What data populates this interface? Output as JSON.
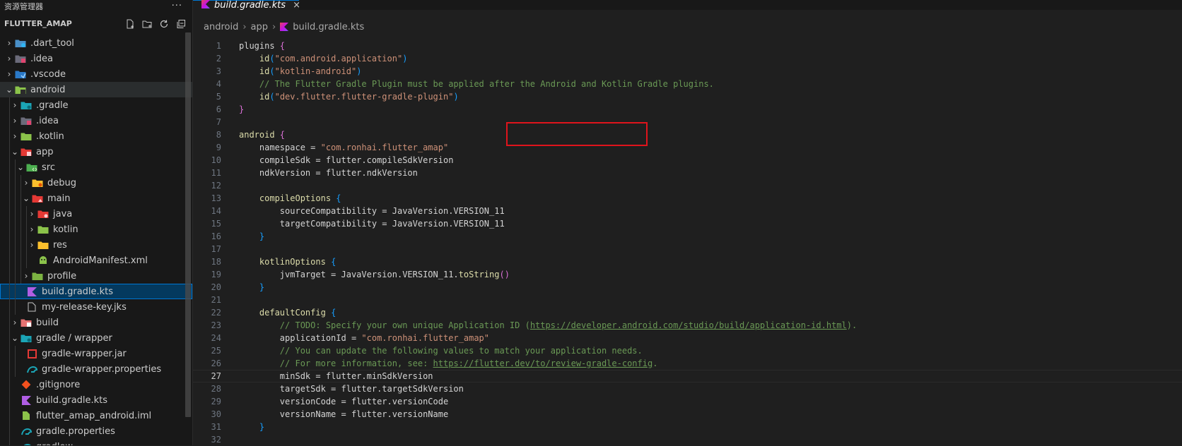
{
  "explorer": {
    "title": "资源管理器",
    "more": "···",
    "root": "FLUTTER_AMAP",
    "items": [
      {
        "label": ".dart_tool",
        "depth": 0,
        "chev": "›",
        "icon": "folder-dart-icon"
      },
      {
        "label": ".idea",
        "depth": 0,
        "chev": "›",
        "icon": "folder-idea-icon"
      },
      {
        "label": ".vscode",
        "depth": 0,
        "chev": "›",
        "icon": "folder-vscode-icon"
      },
      {
        "label": "android",
        "depth": 0,
        "chev": "⌄",
        "icon": "folder-android-icon"
      },
      {
        "label": ".gradle",
        "depth": 1,
        "chev": "›",
        "icon": "folder-gradle-icon"
      },
      {
        "label": ".idea",
        "depth": 1,
        "chev": "›",
        "icon": "folder-idea-icon"
      },
      {
        "label": ".kotlin",
        "depth": 1,
        "chev": "›",
        "icon": "folder-kotlin-icon"
      },
      {
        "label": "app",
        "depth": 1,
        "chev": "⌄",
        "icon": "folder-app-icon"
      },
      {
        "label": "src",
        "depth": 2,
        "chev": "⌄",
        "icon": "folder-src-icon"
      },
      {
        "label": "debug",
        "depth": 3,
        "chev": "›",
        "icon": "folder-debug-icon"
      },
      {
        "label": "main",
        "depth": 3,
        "chev": "⌄",
        "icon": "folder-main-icon"
      },
      {
        "label": "java",
        "depth": 4,
        "chev": "›",
        "icon": "folder-java-icon"
      },
      {
        "label": "kotlin",
        "depth": 4,
        "chev": "›",
        "icon": "folder-kotlin-icon"
      },
      {
        "label": "res",
        "depth": 4,
        "chev": "›",
        "icon": "folder-res-icon"
      },
      {
        "label": "AndroidManifest.xml",
        "depth": 4,
        "chev": "",
        "icon": "android-manifest-icon"
      },
      {
        "label": "profile",
        "depth": 3,
        "chev": "›",
        "icon": "folder-profile-icon"
      },
      {
        "label": "build.gradle.kts",
        "depth": 2,
        "chev": "",
        "icon": "kotlin-file-icon"
      },
      {
        "label": "my-release-key.jks",
        "depth": 2,
        "chev": "",
        "icon": "file-icon"
      },
      {
        "label": "build",
        "depth": 1,
        "chev": "›",
        "icon": "folder-build-icon"
      },
      {
        "label": "gradle / wrapper",
        "depth": 1,
        "chev": "⌄",
        "icon": "folder-gradle-icon"
      },
      {
        "label": "gradle-wrapper.jar",
        "depth": 2,
        "chev": "",
        "icon": "jar-file-icon"
      },
      {
        "label": "gradle-wrapper.properties",
        "depth": 2,
        "chev": "",
        "icon": "gradle-properties-icon"
      },
      {
        "label": ".gitignore",
        "depth": 1,
        "chev": "",
        "icon": "git-icon"
      },
      {
        "label": "build.gradle.kts",
        "depth": 1,
        "chev": "",
        "icon": "kotlin-file-icon"
      },
      {
        "label": "flutter_amap_android.iml",
        "depth": 1,
        "chev": "",
        "icon": "iml-file-icon"
      },
      {
        "label": "gradle.properties",
        "depth": 1,
        "chev": "",
        "icon": "gradle-properties-icon"
      },
      {
        "label": "gradlew",
        "depth": 1,
        "chev": "",
        "icon": "gradle-file-icon"
      }
    ]
  },
  "tab": {
    "label": "build.gradle.kts",
    "close": "×"
  },
  "breadcrumb": [
    "android",
    "app",
    "build.gradle.kts"
  ],
  "code": [
    [
      [
        "plugins ",
        "id"
      ],
      [
        "{",
        "br"
      ]
    ],
    [
      [
        "    ",
        "id"
      ],
      [
        "id",
        "fn"
      ],
      [
        "(",
        "br2"
      ],
      [
        "\"com.android.application\"",
        "str"
      ],
      [
        ")",
        "br2"
      ]
    ],
    [
      [
        "    ",
        "id"
      ],
      [
        "id",
        "fn"
      ],
      [
        "(",
        "br2"
      ],
      [
        "\"kotlin-android\"",
        "str"
      ],
      [
        ")",
        "br2"
      ]
    ],
    [
      [
        "    // The Flutter Gradle Plugin must be applied after the Android and Kotlin Gradle plugins.",
        "cm"
      ]
    ],
    [
      [
        "    ",
        "id"
      ],
      [
        "id",
        "fn"
      ],
      [
        "(",
        "br2"
      ],
      [
        "\"dev.flutter.flutter-gradle-plugin\"",
        "str"
      ],
      [
        ")",
        "br2"
      ]
    ],
    [
      [
        "}",
        "br"
      ]
    ],
    [
      [
        "",
        "id"
      ]
    ],
    [
      [
        "android ",
        "fn"
      ],
      [
        "{",
        "br"
      ]
    ],
    [
      [
        "    namespace = ",
        "id"
      ],
      [
        "\"com.ronhai.flutter_amap\"",
        "str"
      ]
    ],
    [
      [
        "    compileSdk = flutter.compileSdkVersion",
        "id"
      ]
    ],
    [
      [
        "    ndkVersion = flutter.ndkVersion",
        "id"
      ]
    ],
    [
      [
        "",
        "id"
      ]
    ],
    [
      [
        "    ",
        "id"
      ],
      [
        "compileOptions ",
        "fn"
      ],
      [
        "{",
        "br2"
      ]
    ],
    [
      [
        "        sourceCompatibility = JavaVersion.VERSION_11",
        "id"
      ]
    ],
    [
      [
        "        targetCompatibility = JavaVersion.VERSION_11",
        "id"
      ]
    ],
    [
      [
        "    ",
        "id"
      ],
      [
        "}",
        "br2"
      ]
    ],
    [
      [
        "",
        "id"
      ]
    ],
    [
      [
        "    ",
        "id"
      ],
      [
        "kotlinOptions ",
        "fn"
      ],
      [
        "{",
        "br2"
      ]
    ],
    [
      [
        "        jvmTarget = JavaVersion.VERSION_11.",
        "id"
      ],
      [
        "toString",
        "fn"
      ],
      [
        "()",
        "br"
      ]
    ],
    [
      [
        "    ",
        "id"
      ],
      [
        "}",
        "br2"
      ]
    ],
    [
      [
        "",
        "id"
      ]
    ],
    [
      [
        "    ",
        "id"
      ],
      [
        "defaultConfig ",
        "fn"
      ],
      [
        "{",
        "br2"
      ]
    ],
    [
      [
        "        // TODO: Specify your own unique Application ID (",
        "cm"
      ],
      [
        "https://developer.android.com/studio/build/application-id.html",
        "url"
      ],
      [
        ").",
        "cm"
      ]
    ],
    [
      [
        "        applicationId = ",
        "id"
      ],
      [
        "\"com.ronhai.flutter_amap\"",
        "str"
      ]
    ],
    [
      [
        "        // You can update the following values to match your application needs.",
        "cm"
      ]
    ],
    [
      [
        "        // For more information, see: ",
        "cm"
      ],
      [
        "https://flutter.dev/to/review-gradle-config",
        "url"
      ],
      [
        ".",
        "cm"
      ]
    ],
    [
      [
        "        minSdk = flutter.minSdkVersion",
        "id"
      ]
    ],
    [
      [
        "        targetSdk = flutter.targetSdkVersion",
        "id"
      ]
    ],
    [
      [
        "        versionCode = flutter.versionCode",
        "id"
      ]
    ],
    [
      [
        "        versionName = flutter.versionName",
        "id"
      ]
    ],
    [
      [
        "    ",
        "id"
      ],
      [
        "}",
        "br2"
      ]
    ],
    [
      [
        "",
        "id"
      ]
    ]
  ],
  "current_line": 27
}
